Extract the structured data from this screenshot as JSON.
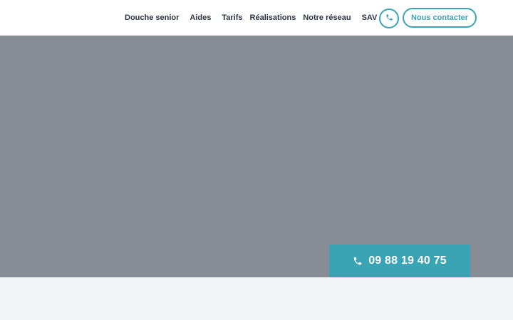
{
  "header": {
    "nav": [
      {
        "label": "Douche senior"
      },
      {
        "label": "Aides"
      },
      {
        "label": "Tarifs"
      },
      {
        "label": "Réalisations"
      },
      {
        "label": "Notre réseau"
      },
      {
        "label": "SAV"
      }
    ],
    "phone_icon": "phone-icon",
    "contact_label": "Nous contacter"
  },
  "hero": {
    "call_number": "09 88 19 40 75",
    "call_icon": "phone-icon"
  },
  "colors": {
    "accent": "#3aa3b4",
    "nav_text": "#2b3444",
    "hero_bg": "#888c95",
    "page_bg": "#f1f3f5",
    "header_bg": "#ffffff"
  }
}
